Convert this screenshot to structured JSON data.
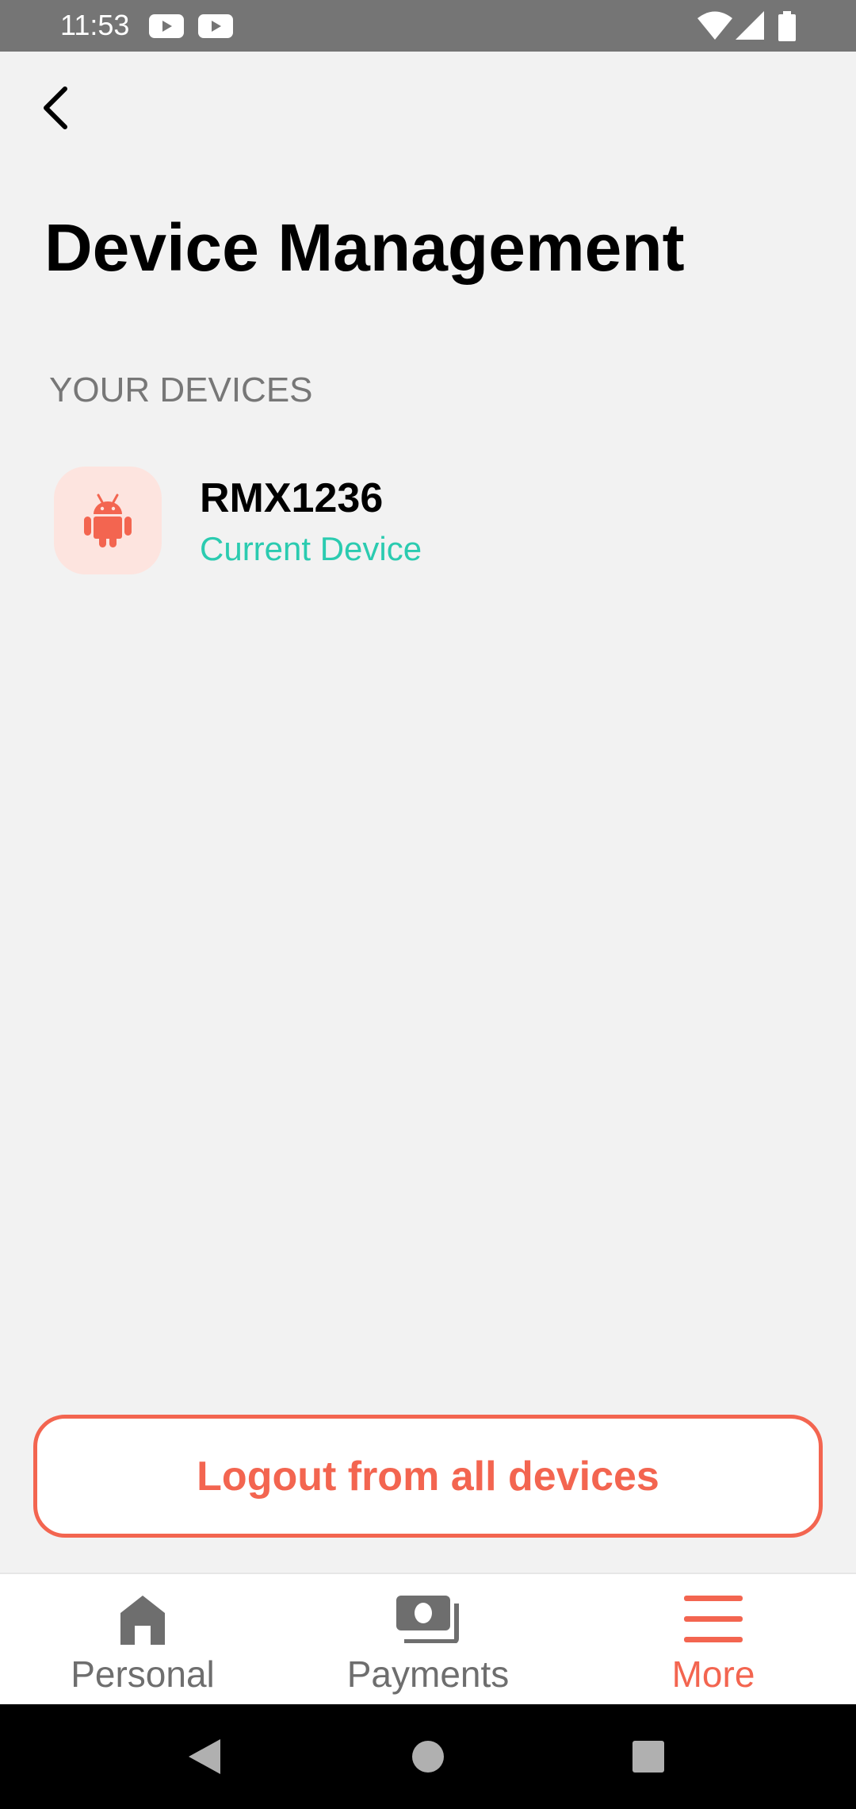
{
  "status_bar": {
    "time": "11:53",
    "icons": [
      "youtube-icon",
      "youtube-icon",
      "wifi-icon",
      "signal-icon",
      "battery-icon"
    ]
  },
  "header": {
    "back_icon": "chevron-left-icon",
    "title": "Device Management"
  },
  "devices_section": {
    "label": "YOUR DEVICES",
    "devices": [
      {
        "icon": "android-icon",
        "name": "RMX1236",
        "status": "Current Device"
      }
    ]
  },
  "logout_button": {
    "label": "Logout from all devices"
  },
  "bottom_nav": {
    "items": [
      {
        "label": "Personal",
        "icon": "home-icon",
        "active": false
      },
      {
        "label": "Payments",
        "icon": "money-icon",
        "active": false
      },
      {
        "label": "More",
        "icon": "menu-icon",
        "active": true
      }
    ]
  },
  "system_nav": {
    "buttons": [
      "back-triangle-icon",
      "home-circle-icon",
      "recents-square-icon"
    ]
  },
  "colors": {
    "accent": "#f36550",
    "current_device": "#2bcbb0",
    "status_bar": "#757575",
    "background": "#f2f2f2",
    "nav_inactive": "#6e6e6e"
  }
}
